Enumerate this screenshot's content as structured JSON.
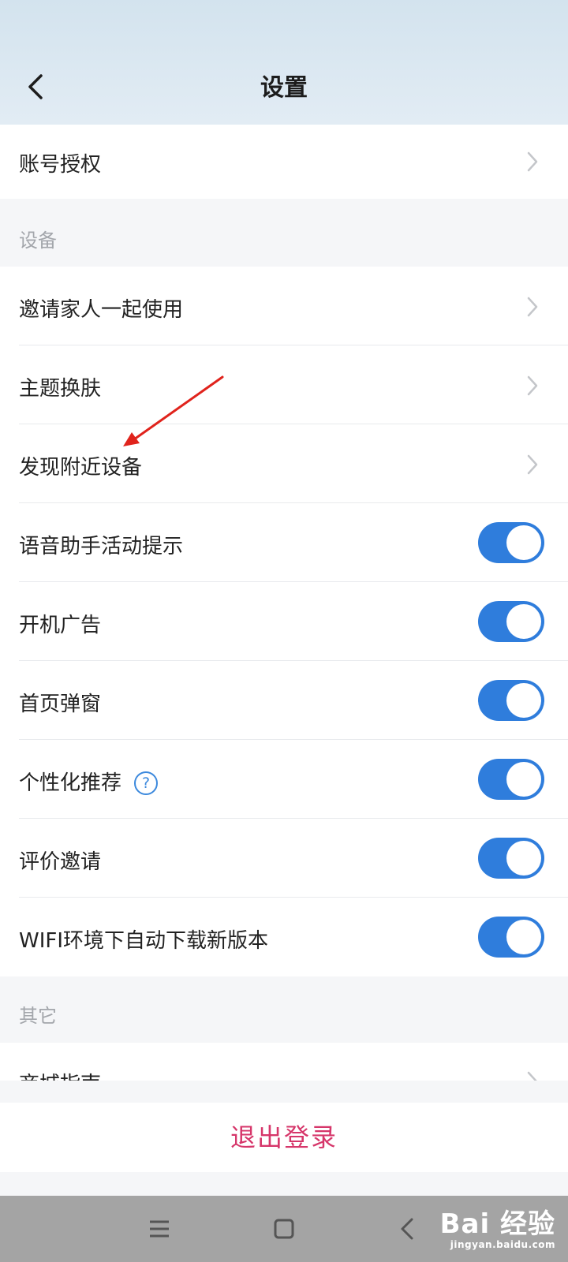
{
  "header": {
    "title": "设置"
  },
  "account": {
    "label": "账号授权"
  },
  "section_device": {
    "label": "设备"
  },
  "device_items": [
    {
      "label": "邀请家人一起使用"
    },
    {
      "label": "主题换肤"
    },
    {
      "label": "发现附近设备"
    }
  ],
  "toggles": [
    {
      "label": "语音助手活动提示",
      "on": true
    },
    {
      "label": "开机广告",
      "on": true
    },
    {
      "label": "首页弹窗",
      "on": true
    },
    {
      "label": "个性化推荐",
      "on": true,
      "help": "?"
    },
    {
      "label": "评价邀请",
      "on": true
    },
    {
      "label": "WIFI环境下自动下载新版本",
      "on": true
    }
  ],
  "section_other": {
    "label": "其它"
  },
  "other_items": [
    {
      "label": "商城指南"
    }
  ],
  "logout": {
    "label": "退出登录"
  },
  "watermark": {
    "line1": "Bai 经验",
    "line2": "jingyan.baidu.com"
  },
  "colors": {
    "accent": "#2f7ddc",
    "logout": "#d6366a",
    "annotation_arrow": "#e0231c"
  }
}
